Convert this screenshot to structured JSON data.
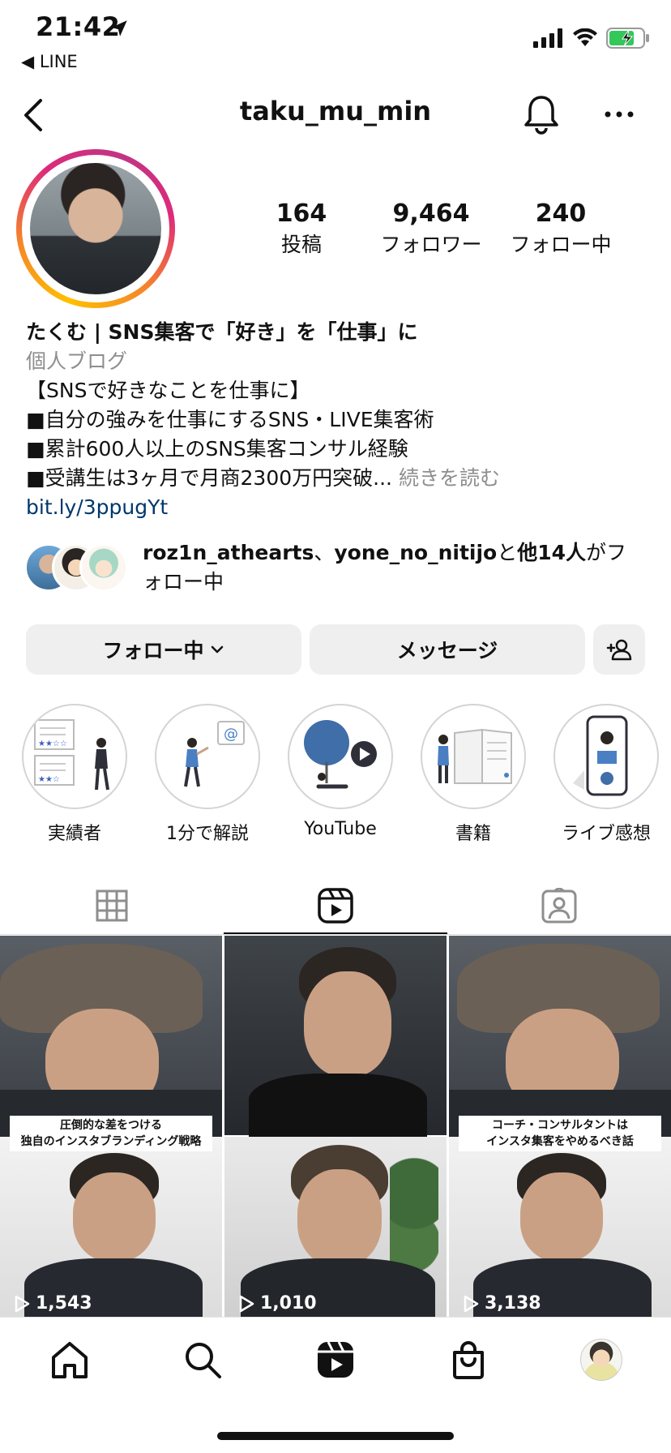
{
  "status_bar": {
    "time": "21:42",
    "back_app": "◀ LINE"
  },
  "header": {
    "username": "taku_mu_min"
  },
  "stats": [
    {
      "value": "164",
      "label": "投稿"
    },
    {
      "value": "9,464",
      "label": "フォロワー"
    },
    {
      "value": "240",
      "label": "フォロー中"
    }
  ],
  "bio": {
    "name": "たくむ | SNS集客で「好き」を「仕事」に",
    "category": "個人ブログ",
    "lines": [
      "【SNSで好きなことを仕事に】",
      "■自分の強みを仕事にするSNS・LIVE集客術",
      "■累計600人以上のSNS集客コンサル経験",
      "■受講生は3ヶ月で月商2300万円突破..."
    ],
    "more": "続きを読む",
    "link": "bit.ly/3ppugYt"
  },
  "followed_by": {
    "user1": "roz1n_athearts",
    "sep": "、",
    "user2": "yone_no_nitijo",
    "mid": "と",
    "others": "他14人",
    "suffix": "がフォロー中"
  },
  "actions": {
    "follow": "フォロー中",
    "message": "メッセージ"
  },
  "highlights": [
    {
      "label": "実績者"
    },
    {
      "label": "1分で解説"
    },
    {
      "label": "YouTube"
    },
    {
      "label": "書籍"
    },
    {
      "label": "ライブ感想"
    }
  ],
  "reels": [
    {
      "caption": "圧倒的な差をつける\n独自のインスタブランディング戦略",
      "views": "1,543"
    },
    {
      "caption": "",
      "views": "1,010"
    },
    {
      "caption": "コーチ・コンサルタントは\nインスタ集客をやめるべき話",
      "views": "3,138"
    }
  ],
  "colors": {
    "link": "#00376b",
    "muted": "#8e8e8e",
    "button_bg": "#efefef",
    "battery": "#34c759"
  }
}
